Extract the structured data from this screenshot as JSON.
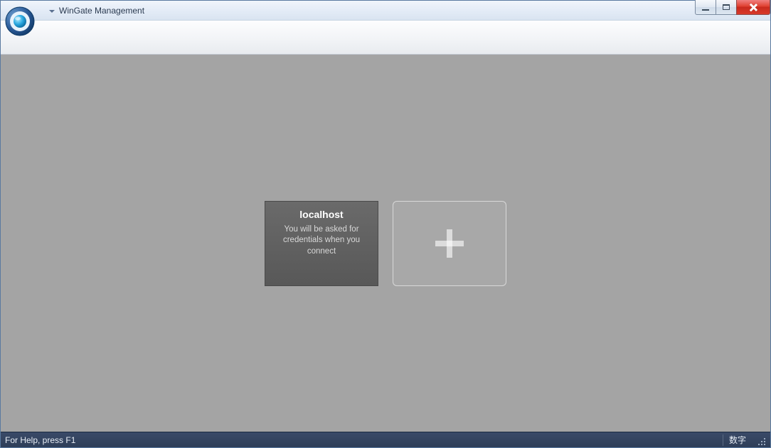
{
  "window": {
    "title": "WinGate Management"
  },
  "main": {
    "connection_tile": {
      "title": "localhost",
      "description": "You will be asked for credentials when you connect"
    }
  },
  "statusbar": {
    "help_text": "For Help, press F1",
    "indicator": "数字"
  }
}
